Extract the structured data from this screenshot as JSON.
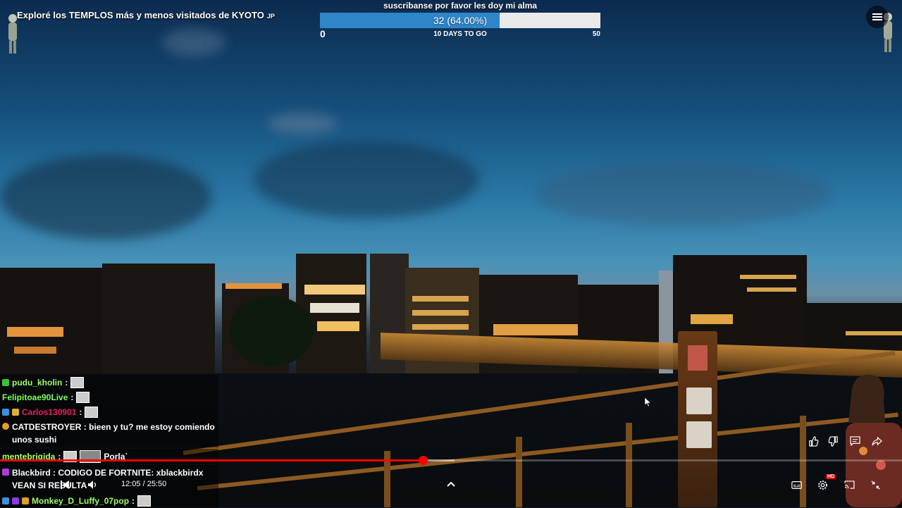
{
  "video": {
    "title": "Exploré los TEMPLOS más y menos visitados de KYOTO",
    "title_flag": "JP"
  },
  "goal": {
    "title": "suscribanse por favor les doy mi alma",
    "current": 32,
    "target": 50,
    "progress_text": "32 (64.00%)",
    "fraction": 0.64,
    "min_label": "0",
    "max_label": "50",
    "days_left": "10 DAYS TO GO",
    "fill_color": "#2e86c9"
  },
  "chat": {
    "messages": [
      {
        "user": "pudu_kholin",
        "user_color": "#9dff6a",
        "text": ":",
        "emote": true
      },
      {
        "user": "Felipitoae90Live",
        "user_color": "#7dff5a",
        "text": ":",
        "emote": true
      },
      {
        "user": "Carlos130901",
        "user_color": "#e0245e",
        "text": ":",
        "emote": true
      },
      {
        "user": "CATDESTROYER",
        "user_color": "#ffffff",
        "text": ": bieen y tu? me estoy comiendo unos sushi"
      },
      {
        "user": "mentebrigida",
        "user_color": "#a8ff6a",
        "text": ":",
        "emote": true,
        "extra": "Porla`"
      },
      {
        "user": "Blackbird",
        "user_color": "#ffffff",
        "text": ": CODIGO DE FORTNITE: xblackbirdx VEAN SI RESULTA"
      },
      {
        "user": "Monkey_D_Luffy_07pop",
        "user_color": "#9dff6a",
        "text": ":",
        "emote": true
      }
    ]
  },
  "player": {
    "current_time": "12:05",
    "duration": "25:50",
    "time_text": "12:05 / 25:50",
    "played_fraction": 0.4684,
    "buffered_fraction": 0.504,
    "hd_badge": "HD",
    "accent_color": "#ff0000",
    "icons": [
      "like-icon",
      "dislike-icon",
      "comment-icon",
      "share-icon",
      "subtitles-icon",
      "settings-icon",
      "cast-icon",
      "exit-fullscreen-icon",
      "chevron-up-icon",
      "previous-icon",
      "volume-icon",
      "menu-icon"
    ]
  }
}
